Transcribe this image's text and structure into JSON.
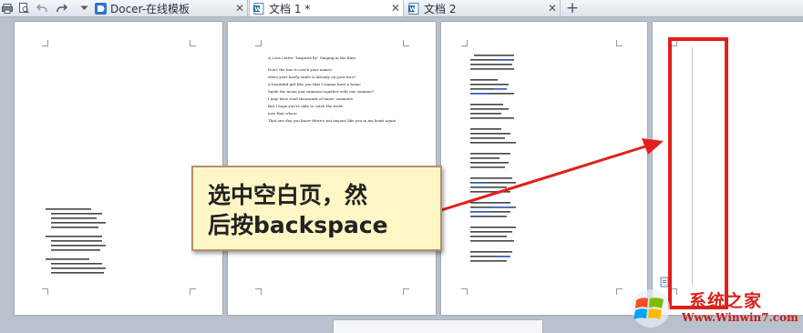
{
  "colors": {
    "accent_red": "#d9221c",
    "callout_bg": "#fdf7c6",
    "workspace": "#b9c2cc"
  },
  "quick_access": [
    {
      "icon": "print-icon"
    },
    {
      "icon": "print-preview-icon"
    },
    {
      "icon": "undo-icon"
    },
    {
      "icon": "redo-icon"
    },
    {
      "icon": "customize-dropdown-icon"
    }
  ],
  "tabs": [
    {
      "label": "Docer-在线模板",
      "icon": "docer-icon",
      "close": "✕",
      "active": false
    },
    {
      "label": "文档 1 *",
      "icon": "writer-doc-icon",
      "close": "✕",
      "active": true
    },
    {
      "label": "文档 2",
      "icon": "writer-doc-icon",
      "close": "✕",
      "active": false
    }
  ],
  "new_tab": "+",
  "page2": {
    "lines": [
      "A Love Letter \"Inspired by\" Singing in the Rain",
      "",
      "Don't the line to catch your names",
      "when your lonely smile is already on your face?",
      "A beautiful girl like you that I wanna have a home",
      "Smile the moon just summon together with one summer?",
      "I may have read thousands of times' summers",
      "But I hope you're able to catch the truth",
      "now that where",
      "That one day you know there's not anyone like you in my heart again"
    ]
  },
  "callout": {
    "line1": "选中空白页，然",
    "line2": "后按backspace"
  },
  "watermark": {
    "title": "系统之家",
    "url": "Www.Winwin7.com"
  }
}
